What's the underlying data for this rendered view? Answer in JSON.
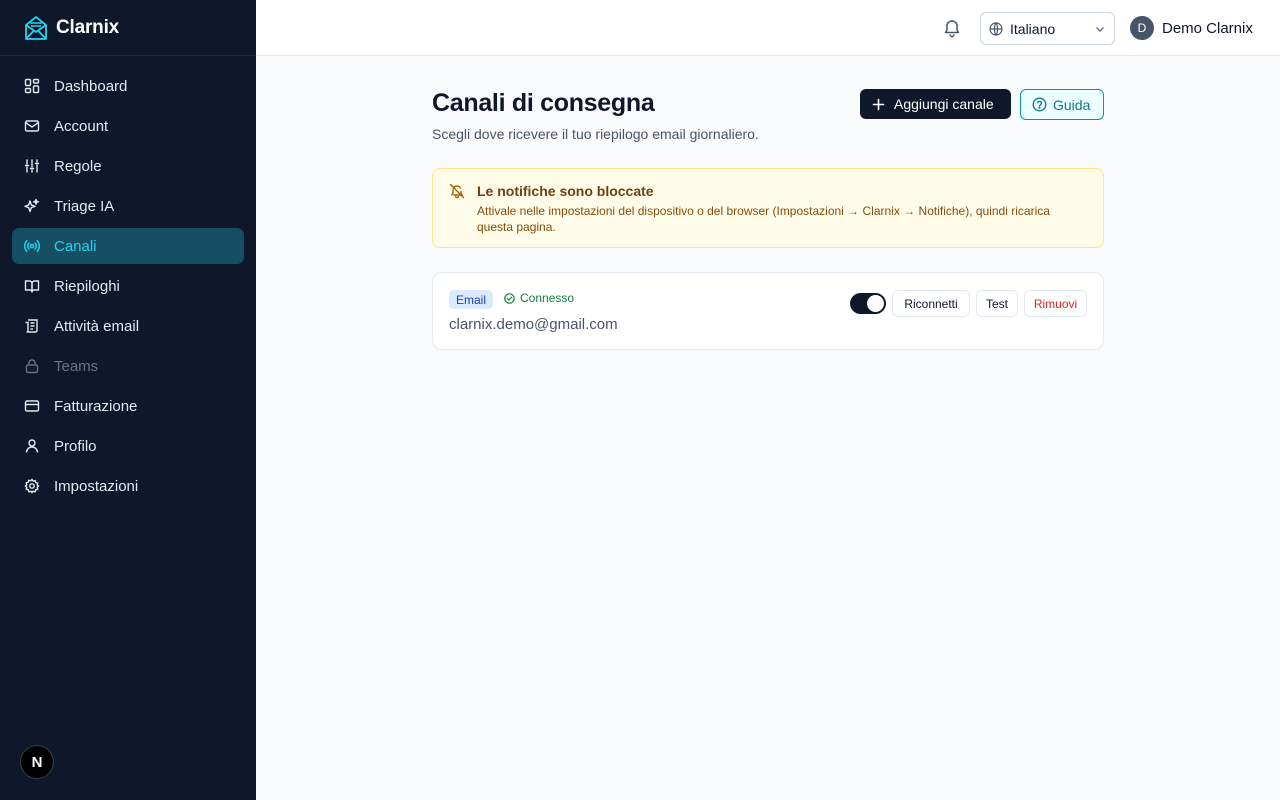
{
  "app": {
    "name": "Clarnix"
  },
  "sidebar": {
    "items": [
      {
        "label": "Dashboard",
        "icon": "dashboard-icon",
        "state": "normal"
      },
      {
        "label": "Account",
        "icon": "mail-icon",
        "state": "normal"
      },
      {
        "label": "Regole",
        "icon": "sliders-icon",
        "state": "normal"
      },
      {
        "label": "Triage IA",
        "icon": "sparkles-icon",
        "state": "normal"
      },
      {
        "label": "Canali",
        "icon": "broadcast-icon",
        "state": "active"
      },
      {
        "label": "Riepiloghi",
        "icon": "book-icon",
        "state": "normal"
      },
      {
        "label": "Attività email",
        "icon": "activity-icon",
        "state": "normal"
      },
      {
        "label": "Teams",
        "icon": "lock-icon",
        "state": "disabled"
      },
      {
        "label": "Fatturazione",
        "icon": "credit-card-icon",
        "state": "normal"
      },
      {
        "label": "Profilo",
        "icon": "user-icon",
        "state": "normal"
      },
      {
        "label": "Impostazioni",
        "icon": "gear-icon",
        "state": "normal"
      }
    ],
    "footer_badge": "N"
  },
  "topbar": {
    "language": "Italiano",
    "user": {
      "initial": "D",
      "name": "Demo Clarnix"
    }
  },
  "main": {
    "title": "Canali di consegna",
    "subtitle": "Scegli dove ricevere il tuo riepilogo email giornaliero.",
    "add_button": "Aggiungi canale",
    "guide_button": "Guida",
    "alert": {
      "title": "Le notifiche sono bloccate",
      "body": "Attivale nelle impostazioni del dispositivo o del browser (Impostazioni → Clarnix → Notifiche), quindi ricarica questa pagina."
    },
    "channel": {
      "type": "Email",
      "status": "Connesso",
      "address": "clarnix.demo@gmail.com",
      "enabled": true,
      "reconnect": "Riconnetti",
      "test": "Test",
      "remove": "Rimuovi"
    }
  },
  "colors": {
    "sidebar_bg": "#0f172a",
    "accent": "#22d3ee",
    "active_bg": "#164e63",
    "danger": "#dc2626",
    "success": "#15803d"
  }
}
